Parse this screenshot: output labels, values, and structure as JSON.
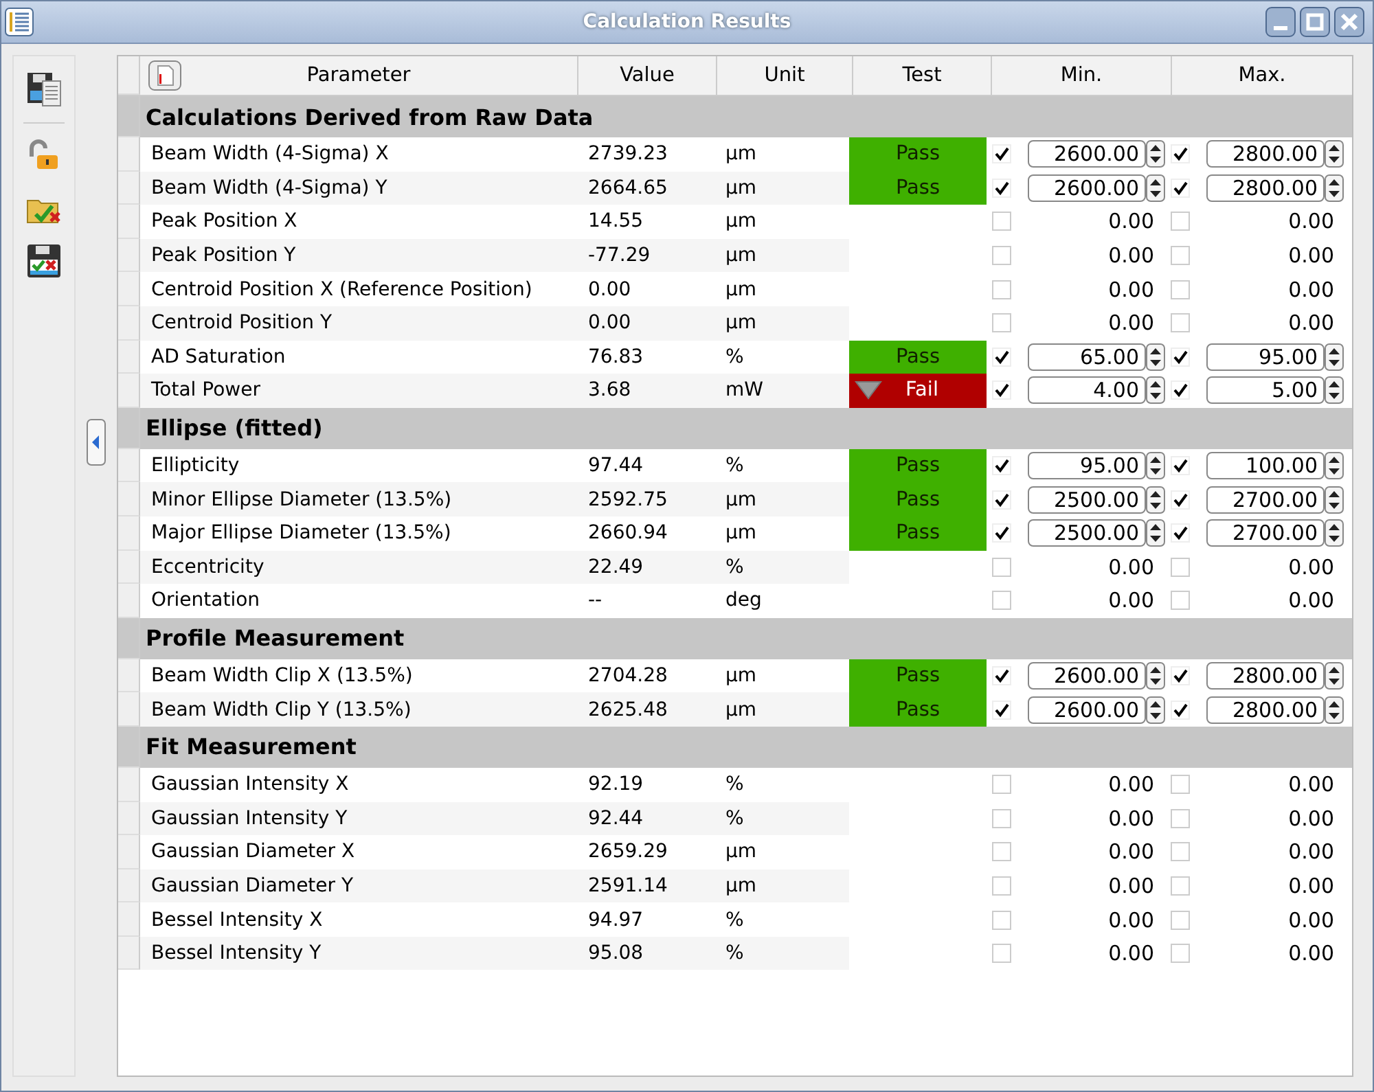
{
  "window": {
    "title": "Calculation Results"
  },
  "table": {
    "columns": [
      "Parameter",
      "Value",
      "Unit",
      "Test",
      "Min.",
      "Max."
    ],
    "sections": [
      {
        "title": "Calculations Derived from Raw Data",
        "rows": [
          {
            "parameter": "Beam Width (4-Sigma) X",
            "value": "2739.23",
            "unit": "µm",
            "test": {
              "kind": "pass",
              "label": "Pass"
            },
            "min": {
              "checked": true,
              "value": "2600.00"
            },
            "max": {
              "checked": true,
              "value": "2800.00"
            }
          },
          {
            "parameter": "Beam Width (4-Sigma) Y",
            "value": "2664.65",
            "unit": "µm",
            "test": {
              "kind": "pass",
              "label": "Pass"
            },
            "min": {
              "checked": true,
              "value": "2600.00"
            },
            "max": {
              "checked": true,
              "value": "2800.00"
            }
          },
          {
            "parameter": "Peak Position X",
            "value": "14.55",
            "unit": "µm",
            "min": {
              "checked": false,
              "value": "0.00"
            },
            "max": {
              "checked": false,
              "value": "0.00"
            }
          },
          {
            "parameter": "Peak Position Y",
            "value": "-77.29",
            "unit": "µm",
            "min": {
              "checked": false,
              "value": "0.00"
            },
            "max": {
              "checked": false,
              "value": "0.00"
            }
          },
          {
            "parameter": "Centroid Position X (Reference Position)",
            "value": "0.00",
            "unit": "µm",
            "min": {
              "checked": false,
              "value": "0.00"
            },
            "max": {
              "checked": false,
              "value": "0.00"
            }
          },
          {
            "parameter": "Centroid Position Y",
            "value": "0.00",
            "unit": "µm",
            "min": {
              "checked": false,
              "value": "0.00"
            },
            "max": {
              "checked": false,
              "value": "0.00"
            }
          },
          {
            "parameter": "AD Saturation",
            "value": "76.83",
            "unit": "%",
            "test": {
              "kind": "pass",
              "label": "Pass"
            },
            "min": {
              "checked": true,
              "value": "65.00"
            },
            "max": {
              "checked": true,
              "value": "95.00"
            }
          },
          {
            "parameter": "Total Power",
            "value": "3.68",
            "unit": "mW",
            "test": {
              "kind": "fail",
              "label": "Fail"
            },
            "min": {
              "checked": true,
              "value": "4.00"
            },
            "max": {
              "checked": true,
              "value": "5.00"
            }
          }
        ]
      },
      {
        "title": "Ellipse (fitted)",
        "rows": [
          {
            "parameter": "Ellipticity",
            "value": "97.44",
            "unit": "%",
            "test": {
              "kind": "pass",
              "label": "Pass"
            },
            "min": {
              "checked": true,
              "value": "95.00"
            },
            "max": {
              "checked": true,
              "value": "100.00"
            }
          },
          {
            "parameter": "Minor Ellipse Diameter (13.5%)",
            "value": "2592.75",
            "unit": "µm",
            "test": {
              "kind": "pass",
              "label": "Pass"
            },
            "min": {
              "checked": true,
              "value": "2500.00"
            },
            "max": {
              "checked": true,
              "value": "2700.00"
            }
          },
          {
            "parameter": "Major Ellipse Diameter (13.5%)",
            "value": "2660.94",
            "unit": "µm",
            "test": {
              "kind": "pass",
              "label": "Pass"
            },
            "min": {
              "checked": true,
              "value": "2500.00"
            },
            "max": {
              "checked": true,
              "value": "2700.00"
            }
          },
          {
            "parameter": "Eccentricity",
            "value": "22.49",
            "unit": "%",
            "min": {
              "checked": false,
              "value": "0.00"
            },
            "max": {
              "checked": false,
              "value": "0.00"
            }
          },
          {
            "parameter": "Orientation",
            "value": "--",
            "unit": "deg",
            "min": {
              "checked": false,
              "value": "0.00"
            },
            "max": {
              "checked": false,
              "value": "0.00"
            }
          }
        ]
      },
      {
        "title": "Profile Measurement",
        "rows": [
          {
            "parameter": "Beam Width Clip X (13.5%)",
            "value": "2704.28",
            "unit": "µm",
            "test": {
              "kind": "pass",
              "label": "Pass"
            },
            "min": {
              "checked": true,
              "value": "2600.00"
            },
            "max": {
              "checked": true,
              "value": "2800.00"
            }
          },
          {
            "parameter": "Beam Width Clip Y (13.5%)",
            "value": "2625.48",
            "unit": "µm",
            "test": {
              "kind": "pass",
              "label": "Pass"
            },
            "min": {
              "checked": true,
              "value": "2600.00"
            },
            "max": {
              "checked": true,
              "value": "2800.00"
            }
          }
        ]
      },
      {
        "title": "Fit Measurement",
        "rows": [
          {
            "parameter": "Gaussian Intensity X",
            "value": "92.19",
            "unit": "%",
            "min": {
              "checked": false,
              "value": "0.00"
            },
            "max": {
              "checked": false,
              "value": "0.00"
            }
          },
          {
            "parameter": "Gaussian Intensity Y",
            "value": "92.44",
            "unit": "%",
            "min": {
              "checked": false,
              "value": "0.00"
            },
            "max": {
              "checked": false,
              "value": "0.00"
            }
          },
          {
            "parameter": "Gaussian Diameter X",
            "value": "2659.29",
            "unit": "µm",
            "min": {
              "checked": false,
              "value": "0.00"
            },
            "max": {
              "checked": false,
              "value": "0.00"
            }
          },
          {
            "parameter": "Gaussian Diameter Y",
            "value": "2591.14",
            "unit": "µm",
            "min": {
              "checked": false,
              "value": "0.00"
            },
            "max": {
              "checked": false,
              "value": "0.00"
            }
          },
          {
            "parameter": "Bessel Intensity X",
            "value": "94.97",
            "unit": "%",
            "min": {
              "checked": false,
              "value": "0.00"
            },
            "max": {
              "checked": false,
              "value": "0.00"
            }
          },
          {
            "parameter": "Bessel Intensity Y",
            "value": "95.08",
            "unit": "%",
            "min": {
              "checked": false,
              "value": "0.00"
            },
            "max": {
              "checked": false,
              "value": "0.00"
            }
          }
        ]
      }
    ]
  }
}
